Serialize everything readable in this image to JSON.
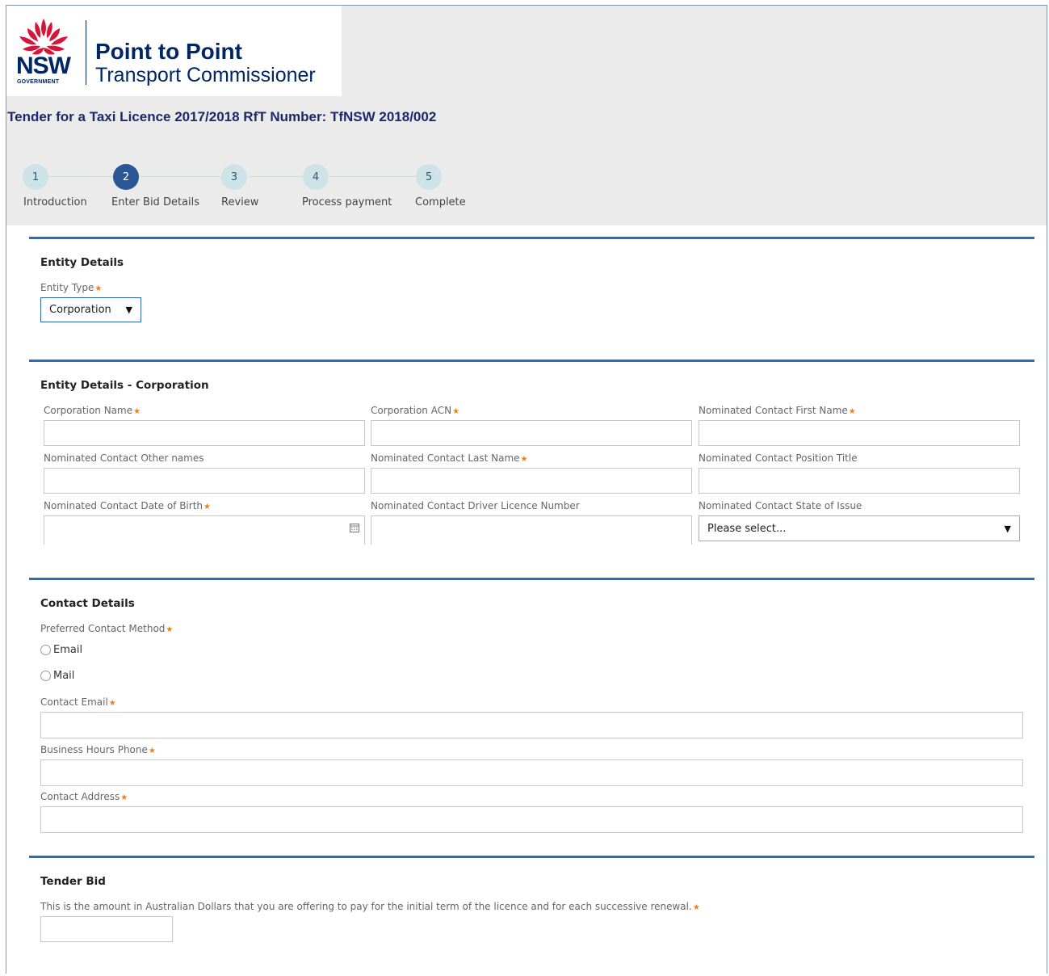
{
  "header": {
    "logo_wordmark": "NSW",
    "logo_gov": "GOVERNMENT",
    "org_line1": "Point to Point",
    "org_line2": "Transport Commissioner",
    "page_title": "Tender for a Taxi Licence 2017/2018 RfT Number: TfNSW 2018/002"
  },
  "steps": [
    {
      "number": "1",
      "label": "Introduction",
      "active": false
    },
    {
      "number": "2",
      "label": "Enter Bid Details",
      "active": true
    },
    {
      "number": "3",
      "label": "Review",
      "active": false
    },
    {
      "number": "4",
      "label": "Process payment",
      "active": false
    },
    {
      "number": "5",
      "label": "Complete",
      "active": false
    }
  ],
  "entity": {
    "title": "Entity Details",
    "type_label": "Entity Type",
    "type_value": "Corporation"
  },
  "corporation": {
    "title": "Entity Details - Corporation",
    "name_label": "Corporation Name",
    "acn_label": "Corporation ACN",
    "first_name_label": "Nominated Contact First Name",
    "other_names_label": "Nominated Contact Other names",
    "last_name_label": "Nominated Contact Last Name",
    "position_label": "Nominated Contact Position Title",
    "dob_label": "Nominated Contact Date of Birth",
    "licence_label": "Nominated Contact Driver Licence Number",
    "state_label": "Nominated Contact State of Issue",
    "state_value": "Please select..."
  },
  "contact": {
    "title": "Contact Details",
    "method_label": "Preferred Contact Method",
    "option_email": "Email",
    "option_mail": "Mail",
    "email_label": "Contact Email",
    "phone_label": "Business Hours Phone",
    "address_label": "Contact Address"
  },
  "tender": {
    "title": "Tender Bid",
    "amount_label": "This is the amount in Australian Dollars that you are offering to pay for the initial term of the licence and for each successive renewal."
  },
  "required_marker": "★",
  "colors": {
    "brand_navy": "#002664",
    "section_rule": "#2a6eb5",
    "step_active": "#2b5797",
    "step_inactive": "#cde3e8",
    "required": "#e8811c"
  }
}
